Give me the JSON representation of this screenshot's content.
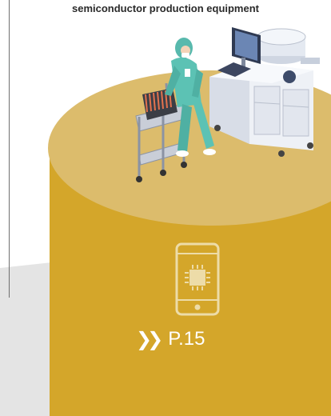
{
  "caption": "semiconductor production equipment",
  "link": {
    "chevrons": "❯❯",
    "label": "P.15"
  },
  "icons": {
    "device": "smartphone-chip-icon",
    "link_arrow": "double-chevron-right-icon"
  },
  "colors": {
    "cylinder_body": "#d4a62a",
    "cylinder_top": "#dcbc6c",
    "grey_band": "#e4e4e4",
    "icon_stroke": "#eddca8",
    "text_dark": "#2a2a2a"
  }
}
